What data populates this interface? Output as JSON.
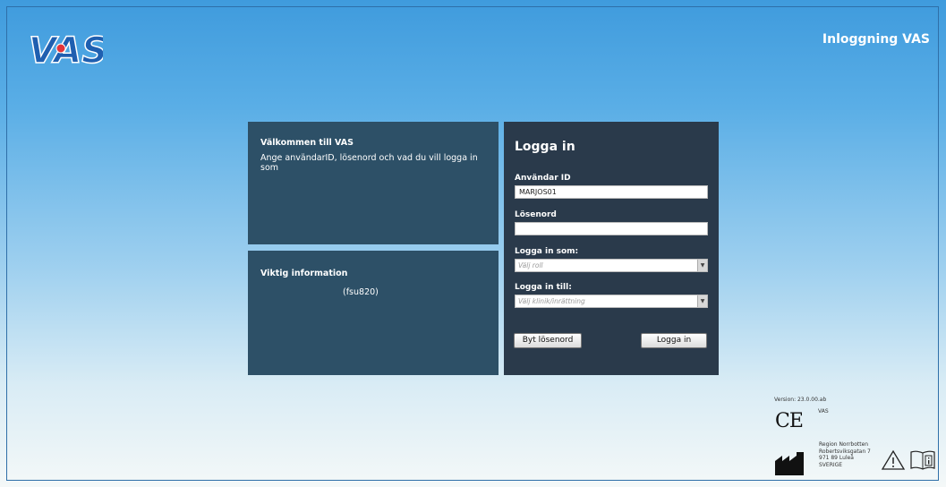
{
  "header": {
    "logo_text": "VAS",
    "title": "Inloggning VAS"
  },
  "welcome": {
    "title": "Välkommen till VAS",
    "text": "Ange användarID, lösenord och vad du vill logga in som"
  },
  "info": {
    "title": "Viktig information",
    "code": "(fsu820)"
  },
  "login": {
    "heading": "Logga in",
    "user_label": "Användar ID",
    "user_value": "MARJOS01",
    "password_label": "Lösenord",
    "password_value": "",
    "role_label": "Logga in som:",
    "role_placeholder": "Välj roll",
    "clinic_label": "Logga in till:",
    "clinic_placeholder": "Välj klinik/inrättning",
    "change_password_button": "Byt lösenord",
    "login_button": "Logga in"
  },
  "footer": {
    "version": "Version: 23.0.00.ab",
    "ce_mark": "CE",
    "ce_label": "VAS",
    "address": [
      "Region Norrbotten",
      "Robertsviksgatan 7",
      "971 89 Luleå",
      "SVERIGE"
    ]
  },
  "colors": {
    "panel_blue": "#2d5067",
    "panel_dark": "#2a3a4b",
    "logo_red": "#e3343a"
  }
}
